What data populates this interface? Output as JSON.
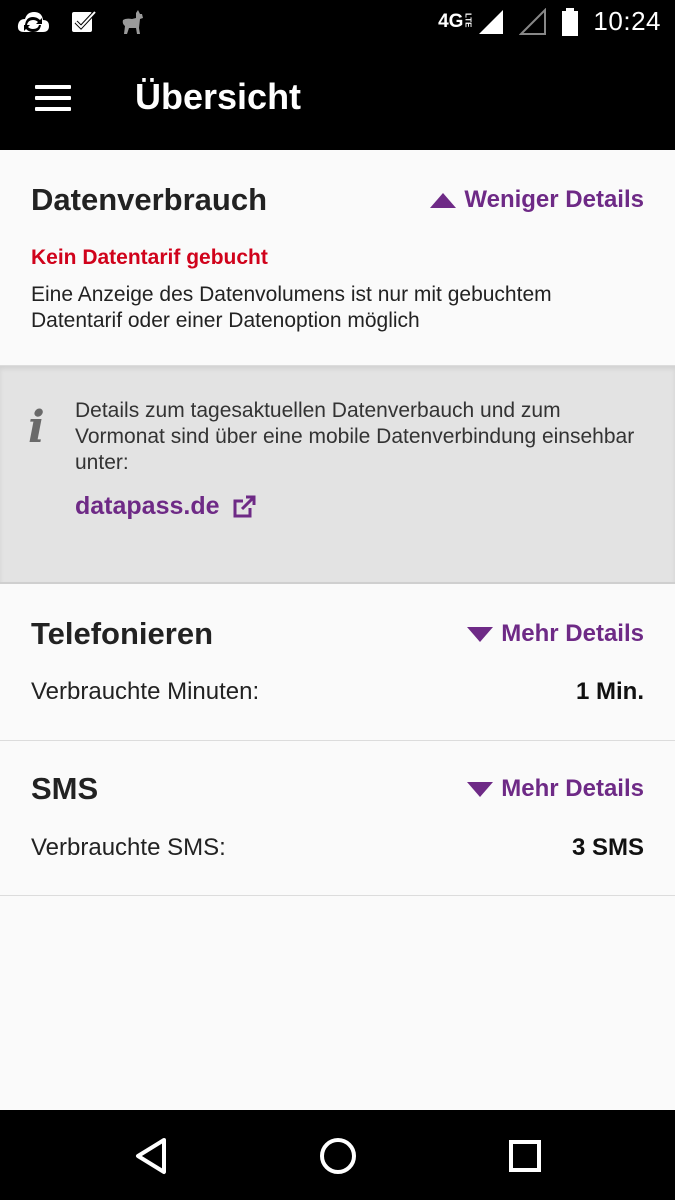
{
  "statusbar": {
    "network": "4G",
    "network_sub": "LTE",
    "time": "10:24",
    "icons": [
      "cloud-sync-icon",
      "checkbox-icon",
      "animal-icon",
      "signal-icon",
      "signal-empty-icon",
      "battery-icon"
    ]
  },
  "toolbar": {
    "title": "Übersicht",
    "menu_icon": "menu-icon"
  },
  "data_section": {
    "title": "Datenverbrauch",
    "toggle_label": "Weniger Details",
    "warning": "Kein Datentarif gebucht",
    "description": "Eine Anzeige des Datenvolumens ist nur mit gebuchtem Datentarif oder einer Datenoption möglich"
  },
  "info_box": {
    "icon": "i",
    "text": "Details zum tagesaktuellen Datenverbauch und zum Vormonat sind über eine mobile Datenverbindung einsehbar unter:",
    "link": "datapass.de"
  },
  "calls_section": {
    "title": "Telefonieren",
    "toggle_label": "Mehr Details",
    "row_label": "Verbrauchte Minuten:",
    "row_value": "1 Min."
  },
  "sms_section": {
    "title": "SMS",
    "toggle_label": "Mehr Details",
    "row_label": "Verbrauchte SMS:",
    "row_value": "3 SMS"
  },
  "colors": {
    "accent": "#6e2a86",
    "warning": "#d0021b",
    "bar": "#000000"
  }
}
